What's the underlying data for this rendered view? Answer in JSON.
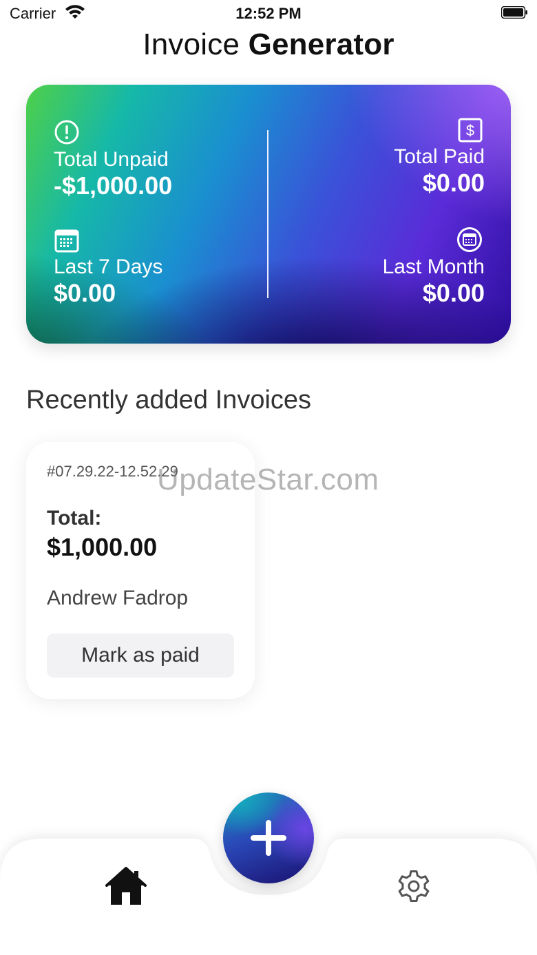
{
  "status_bar": {
    "carrier": "Carrier",
    "time": "12:52 PM"
  },
  "header": {
    "title_light": "Invoice",
    "title_bold": "Generator"
  },
  "summary": {
    "total_unpaid": {
      "label": "Total Unpaid",
      "value": "-$1,000.00",
      "icon": "alert-circle-icon"
    },
    "total_paid": {
      "label": "Total Paid",
      "value": "$0.00",
      "icon": "dollar-square-icon"
    },
    "last_7_days": {
      "label": "Last 7 Days",
      "value": "$0.00",
      "icon": "calendar-icon"
    },
    "last_month": {
      "label": "Last Month",
      "value": "$0.00",
      "icon": "calendar-circle-icon"
    }
  },
  "recent": {
    "section_title": "Recently added Invoices",
    "invoices": [
      {
        "number": "#07.29.22-12.52.29",
        "total_label": "Total:",
        "total_value": "$1,000.00",
        "client": "Andrew Fadrop",
        "action_label": "Mark as paid"
      }
    ]
  },
  "watermark": "UpdateStar.com",
  "tab_bar": {
    "home_icon": "home-icon",
    "add_icon": "plus-icon",
    "settings_icon": "gear-icon"
  }
}
